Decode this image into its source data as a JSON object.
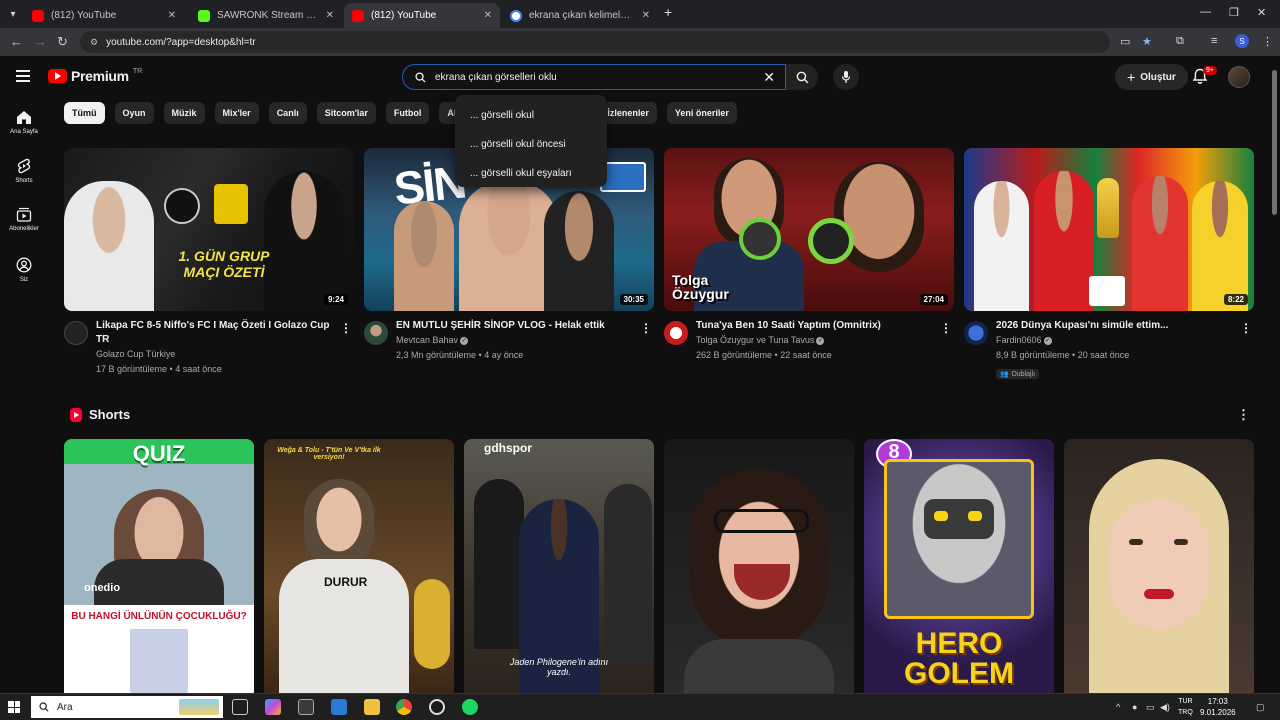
{
  "browser": {
    "tabs": [
      {
        "title": "(812) YouTube",
        "fav": "#ff0000",
        "active": false
      },
      {
        "title": "SAWRONK Stream - Watch Live",
        "fav": "#53fc18",
        "active": false
      },
      {
        "title": "(812) YouTube",
        "fav": "#ff0000",
        "active": true
      },
      {
        "title": "ekrana çıkan kelimeleri okuma",
        "fav": "#4285f4",
        "active": false
      }
    ],
    "url": "youtube.com/?app=desktop&hl=tr",
    "profile_letter": "S"
  },
  "yt": {
    "logo_text": "Premium",
    "logo_country": "TR",
    "search_value": "ekrana çıkan görselleri oklu",
    "suggestions": [
      "... görselli okul",
      "... görselli okul öncesi",
      "... görselli okul eşyaları"
    ],
    "create_label": "Oluştur",
    "notif_count": "9+"
  },
  "sidebar": [
    {
      "label": "Ana Sayfa",
      "icon": "home-icon"
    },
    {
      "label": "Shorts",
      "icon": "shorts-icon"
    },
    {
      "label": "Abonelikler",
      "icon": "subscriptions-icon"
    },
    {
      "label": "Siz",
      "icon": "you-icon"
    }
  ],
  "chips": [
    "Tümü",
    "Oyun",
    "Müzik",
    "Mix'ler",
    "Canlı",
    "Sitcom'lar",
    "Futbol",
    "Aksiyon",
    "Yakın zamanda yüklenenler",
    "İzlenenler",
    "Yeni öneriler"
  ],
  "chips_visible": [
    "Tümü",
    "Oyun",
    "Müzik",
    "Mix'ler",
    "Canlı",
    "Sitcom'lar",
    "Futbol",
    "Aksiyo",
    "nler",
    "İzlenenler",
    "Yeni öneriler"
  ],
  "videos": [
    {
      "title": "Likapa FC 8-5 Niffo's FC I Maç Özeti I Golazo Cup TR",
      "channel": "Golazo Cup Türkiye",
      "stats": "17 B görüntüleme • 4 saat önce",
      "duration": "9:24",
      "thumb_text": "1. GÜN GRUP MAÇI ÖZETİ"
    },
    {
      "title": "EN MUTLU ŞEHİR SİNOP VLOG - Helak ettik",
      "channel": "Mevtcan Bahav",
      "stats": "2,3 Mn görüntüleme • 4 ay önce",
      "duration": "30:35",
      "thumb_text": "SİN"
    },
    {
      "title": "Tuna'ya Ben 10 Saati Yaptım (Omnitrix)",
      "channel": "Tolga Özuygur ve Tuna Tavus",
      "stats": "262 B görüntüleme • 22 saat önce",
      "duration": "27:04",
      "thumb_text": "Tolga Özuygur"
    },
    {
      "title": "2026 Dünya Kupası'nı simüle ettim...",
      "channel": "Fardin0606",
      "stats": "8,9 B görüntüleme • 20 saat önce",
      "duration": "8:22",
      "badge": "Dublajlı"
    }
  ],
  "shorts": {
    "heading": "Shorts",
    "items": [
      {
        "top_text": "QUIZ",
        "bottom_text": "BU HANGİ ÜNLÜNÜN ÇOCUKLUĞU?",
        "brand": "onedio"
      },
      {
        "top_text": "DURUR",
        "caption": "Weğa & Tolu - T'tün Ve V'tka ilk versiyon!"
      },
      {
        "top_text": "gdhspor",
        "caption": "Jaden Philogene'in adını yazdı."
      },
      {
        "top_text": ""
      },
      {
        "top_text": "8",
        "caption": "HERO GOLEM"
      },
      {
        "top_text": ""
      }
    ]
  },
  "taskbar": {
    "search": "Ara",
    "lang": "TUR",
    "lang2": "TRQ",
    "time": "17:03",
    "date": "9.01.2026"
  }
}
